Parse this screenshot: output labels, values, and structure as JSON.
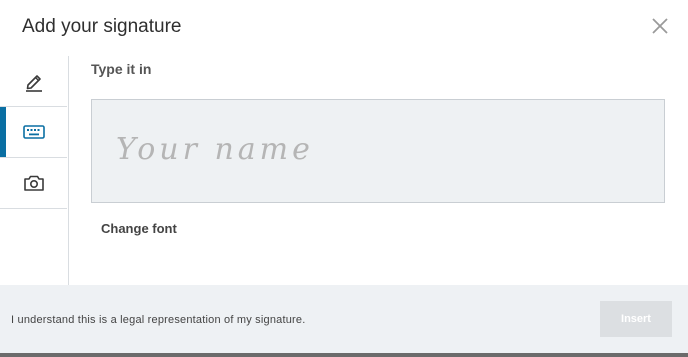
{
  "dialog": {
    "title": "Add your signature"
  },
  "tabs": [
    {
      "icon": "pencil-icon",
      "active": false
    },
    {
      "icon": "keyboard-icon",
      "active": true
    },
    {
      "icon": "camera-icon",
      "active": false
    }
  ],
  "type_panel": {
    "section_label": "Type it in",
    "signature_value": "",
    "signature_placeholder": "Your name",
    "change_font_label": "Change font"
  },
  "footer": {
    "legal_text": "I understand this is a legal representation of my signature.",
    "insert_label": "Insert"
  },
  "colors": {
    "accent": "#0a6fa3",
    "signature_box_bg": "#eef1f3",
    "footer_bg": "#eef1f4",
    "insert_disabled_bg": "#dcdfe2"
  }
}
